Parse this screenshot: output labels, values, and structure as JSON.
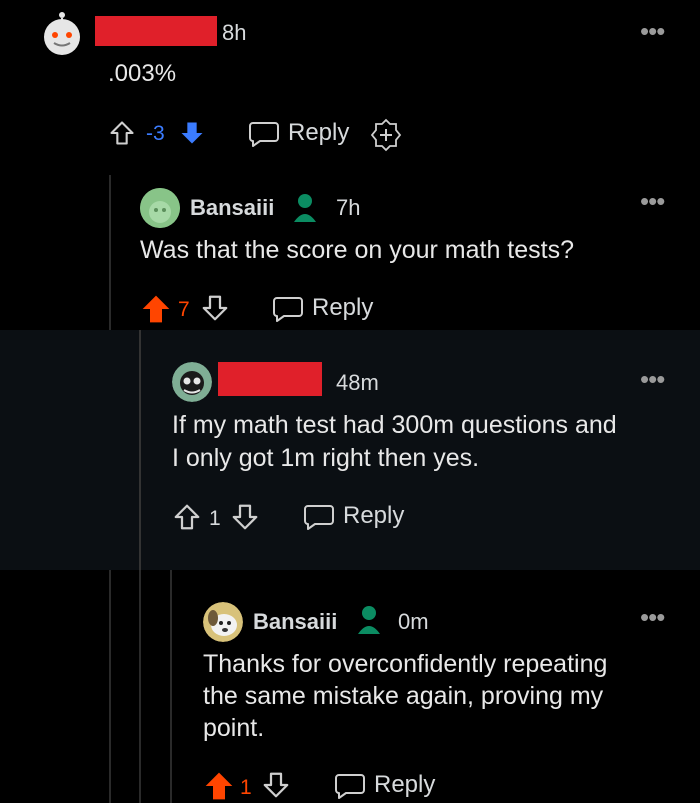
{
  "comments": [
    {
      "id": "c1",
      "username": "",
      "time": "8h",
      "text": ".003%",
      "score": "-3",
      "vote": "down",
      "reply_label": "Reply",
      "more": "•••"
    },
    {
      "id": "c2",
      "username": "Bansaiii",
      "time": "7h",
      "text": "Was that the score on your math tests?",
      "score": "7",
      "vote": "up",
      "reply_label": "Reply",
      "more": "•••"
    },
    {
      "id": "c3",
      "username": "",
      "time": "48m",
      "text_lines": [
        "If my math test had 300m questions and",
        "I only got 1m right then yes."
      ],
      "score": "1",
      "vote": "none",
      "reply_label": "Reply",
      "more": "•••"
    },
    {
      "id": "c4",
      "username": "Bansaiii",
      "time": "0m",
      "text_lines": [
        "Thanks for overconfidently repeating",
        "the same mistake again, proving my",
        "point."
      ],
      "score": "1",
      "vote": "up",
      "reply_label": "Reply",
      "more": "•••"
    }
  ],
  "colors": {
    "upvote": "#ff4500",
    "downvote": "#3b7cff",
    "online": "#0b8c62",
    "redaction": "#e0202a",
    "background": "#000000"
  },
  "icons": [
    "up-arrow-icon",
    "down-arrow-icon",
    "speech-bubble-icon",
    "add-award-icon",
    "online-user-icon",
    "more-options-icon"
  ]
}
